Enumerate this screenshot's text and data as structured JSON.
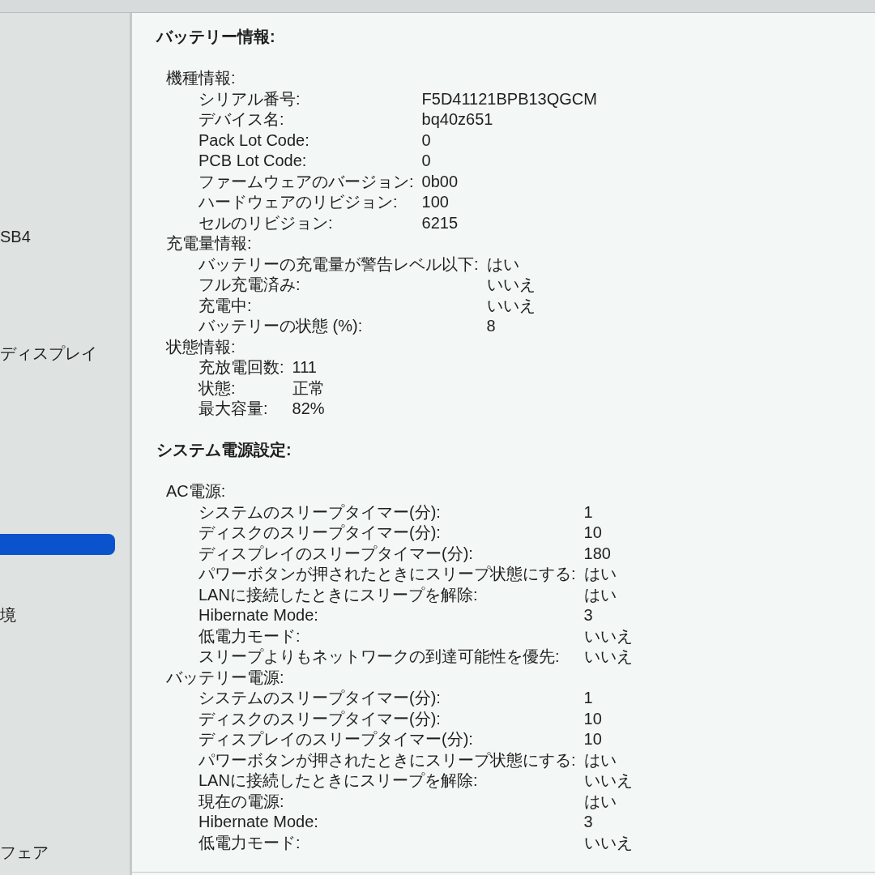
{
  "sidebar": {
    "items": [
      {
        "label": "SB4",
        "selected": false
      },
      {
        "label": "ディスプレイ",
        "selected": false
      },
      {
        "selected": true
      },
      {
        "label": "境",
        "selected": false
      },
      {
        "label": "フェア",
        "selected": false
      }
    ]
  },
  "sections": [
    {
      "title": "バッテリー情報:",
      "groups": [
        {
          "title": "機種情報:",
          "rows": [
            {
              "label": "シリアル番号:",
              "value": "F5D41121BPB13QGCM"
            },
            {
              "label": "デバイス名:",
              "value": "bq40z651"
            },
            {
              "label": "Pack Lot Code:",
              "value": "0"
            },
            {
              "label": "PCB Lot Code:",
              "value": "0"
            },
            {
              "label": "ファームウェアのバージョン:",
              "value": "0b00"
            },
            {
              "label": "ハードウェアのリビジョン:",
              "value": "100"
            },
            {
              "label": "セルのリビジョン:",
              "value": "6215"
            }
          ]
        },
        {
          "title": "充電量情報:",
          "rows": [
            {
              "label": "バッテリーの充電量が警告レベル以下:",
              "value": "はい"
            },
            {
              "label": "フル充電済み:",
              "value": "いいえ"
            },
            {
              "label": "充電中:",
              "value": "いいえ"
            },
            {
              "label": "バッテリーの状態 (%):",
              "value": "8"
            }
          ]
        },
        {
          "title": "状態情報:",
          "rows": [
            {
              "label": "充放電回数:",
              "value": "111"
            },
            {
              "label": "状態:",
              "value": "正常"
            },
            {
              "label": "最大容量:",
              "value": "82%"
            }
          ]
        }
      ]
    },
    {
      "title": "システム電源設定:",
      "groups": [
        {
          "title": "AC電源:",
          "rows": [
            {
              "label": "システムのスリープタイマー(分):",
              "value": "1"
            },
            {
              "label": "ディスクのスリープタイマー(分):",
              "value": "10"
            },
            {
              "label": "ディスプレイのスリープタイマー(分):",
              "value": "180"
            },
            {
              "label": "パワーボタンが押されたときにスリープ状態にする:",
              "value": "はい"
            },
            {
              "label": "LANに接続したときにスリープを解除:",
              "value": "はい"
            },
            {
              "label": "Hibernate Mode:",
              "value": "3"
            },
            {
              "label": "低電力モード:",
              "value": "いいえ"
            },
            {
              "label": "スリープよりもネットワークの到達可能性を優先:",
              "value": "いいえ"
            }
          ]
        },
        {
          "title": "バッテリー電源:",
          "rows": [
            {
              "label": "システムのスリープタイマー(分):",
              "value": "1"
            },
            {
              "label": "ディスクのスリープタイマー(分):",
              "value": "10"
            },
            {
              "label": "ディスプレイのスリープタイマー(分):",
              "value": "10"
            },
            {
              "label": "パワーボタンが押されたときにスリープ状態にする:",
              "value": "はい"
            },
            {
              "label": "LANに接続したときにスリープを解除:",
              "value": "いいえ"
            },
            {
              "label": "現在の電源:",
              "value": "はい"
            },
            {
              "label": "Hibernate Mode:",
              "value": "3"
            },
            {
              "label": "低電力モード:",
              "value": "いいえ"
            }
          ]
        }
      ]
    }
  ]
}
